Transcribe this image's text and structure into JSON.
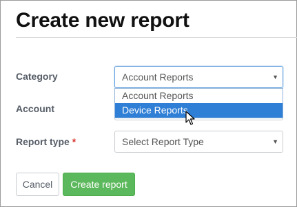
{
  "page": {
    "title": "Create new report"
  },
  "form": {
    "category": {
      "label": "Category",
      "value": "Account Reports",
      "options": [
        "Account Reports",
        "Device Reports"
      ],
      "highlighted": "Device Reports"
    },
    "account": {
      "label": "Account"
    },
    "report_type": {
      "label": "Report type",
      "required_mark": "*",
      "placeholder": "Select Report Type"
    }
  },
  "buttons": {
    "cancel": "Cancel",
    "create": "Create report"
  },
  "colors": {
    "primary": "#5cb85c",
    "highlight": "#2f7fd6",
    "required": "#d9342b",
    "focus_border": "#66a3e0"
  },
  "icons": {
    "caret": "triangle-down",
    "cursor": "arrow-pointer"
  }
}
